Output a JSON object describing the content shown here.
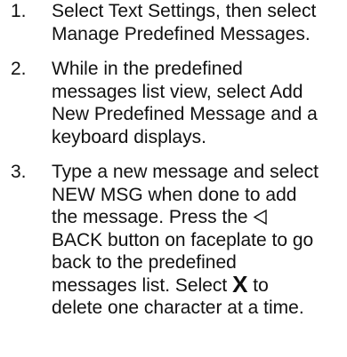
{
  "steps": [
    {
      "number": "1.",
      "text": "Select Text Settings, then select Manage Predefined Messages."
    },
    {
      "number": "2.",
      "text": "While in the predefined messages list view, select Add New Predefined Message and a keyboard displays."
    },
    {
      "number": "3.",
      "text_before_back": "Type a new message and select NEW MSG when done to add the message. Press the ",
      "back_label": "BACK button on faceplate to go back to the predefined messages list. Select ",
      "delete_glyph": "X",
      "text_after_delete": " to delete one character at a time.",
      "back_icon": "back-triangle-icon"
    }
  ]
}
